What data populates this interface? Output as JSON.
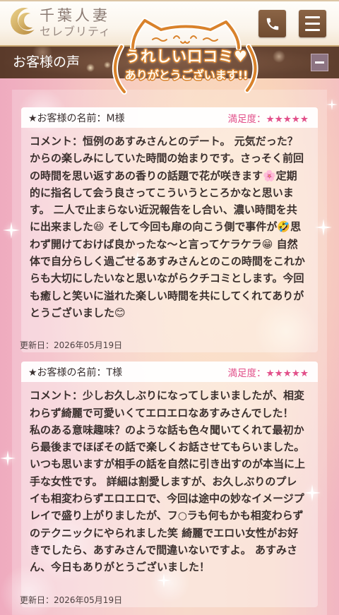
{
  "header": {
    "logo": {
      "line1": "千葉人妻",
      "line2": "セレブリティ",
      "icon": "crescent-moon-icon"
    },
    "phone_button": {
      "icon": "phone-icon"
    },
    "menu_button": {
      "icon": "hamburger-menu-icon"
    }
  },
  "section": {
    "title": "お客様の声",
    "toggle_icon": "minus-icon",
    "stamp": {
      "line1": "うれしい口コミ♥",
      "line2": "ありがとうございます!!",
      "icon": "cat-face-icon"
    }
  },
  "reviews": [
    {
      "name": "★お客様の名前：M様",
      "rating_label": "満足度：",
      "rating_stars": "★★★★★",
      "comment": "コメント：恒例のあすみさんとのデート。 元気だった？からの楽しみにしていた時間の始まりです。さっそく前回の時間を思い返すあの香りの話題で花が咲きます🌸定期的に指名して会う良さってこういうところかなと思います。 二人で止まらない近況報告をし合い、濃い時間を共に出来ました😆 そして今回も扉の向こう側で事件が🤣思わず開けておけば良かったな〜と言ってケラケラ😁 自然体で自分らしく過ごせるあすみさんとのこの時間をこれからも大切にしたいなと思いながらクチコミとします。今回も癒しと笑いに溢れた楽しい時間を共にしてくれてありがとうございました😊",
      "updated": "更新日：2026年05月19日"
    },
    {
      "name": "★お客様の名前：T様",
      "rating_label": "満足度：",
      "rating_stars": "★★★★★",
      "comment": "コメント：少しお久しぶりになってしまいましたが、相変わらず綺麗で可愛いくてエロエロなあすみさんでした！ 私のある意味趣味？のような話も色々聞いてくれて最初から最後までほぼその話で楽しくお話させてもらいました。いつも思いますが相手の話を自然に引き出すのが本当に上手な女性です。 詳細は割愛しますが、お久しぶりのプレイも相変わらずエロエロで、今回は途中の妙なイメージプレイで盛り上がりましたが、フ○ラも何もかも相変わらずのテクニックにやられました笑 綺麗でエロい女性がお好きでしたら、あすみさんで間違いないですよ。 あすみさん、今日もありがとうございました！",
      "updated": "更新日：2026年05月19日"
    }
  ],
  "colors": {
    "header_button": "#75502f",
    "section_bar": "#6a4735",
    "rating_pink": "#e2508a",
    "stamp_orange": "#d9822b",
    "logo_gold": "#c9a24a",
    "background_pink": "#f4bfc3"
  }
}
